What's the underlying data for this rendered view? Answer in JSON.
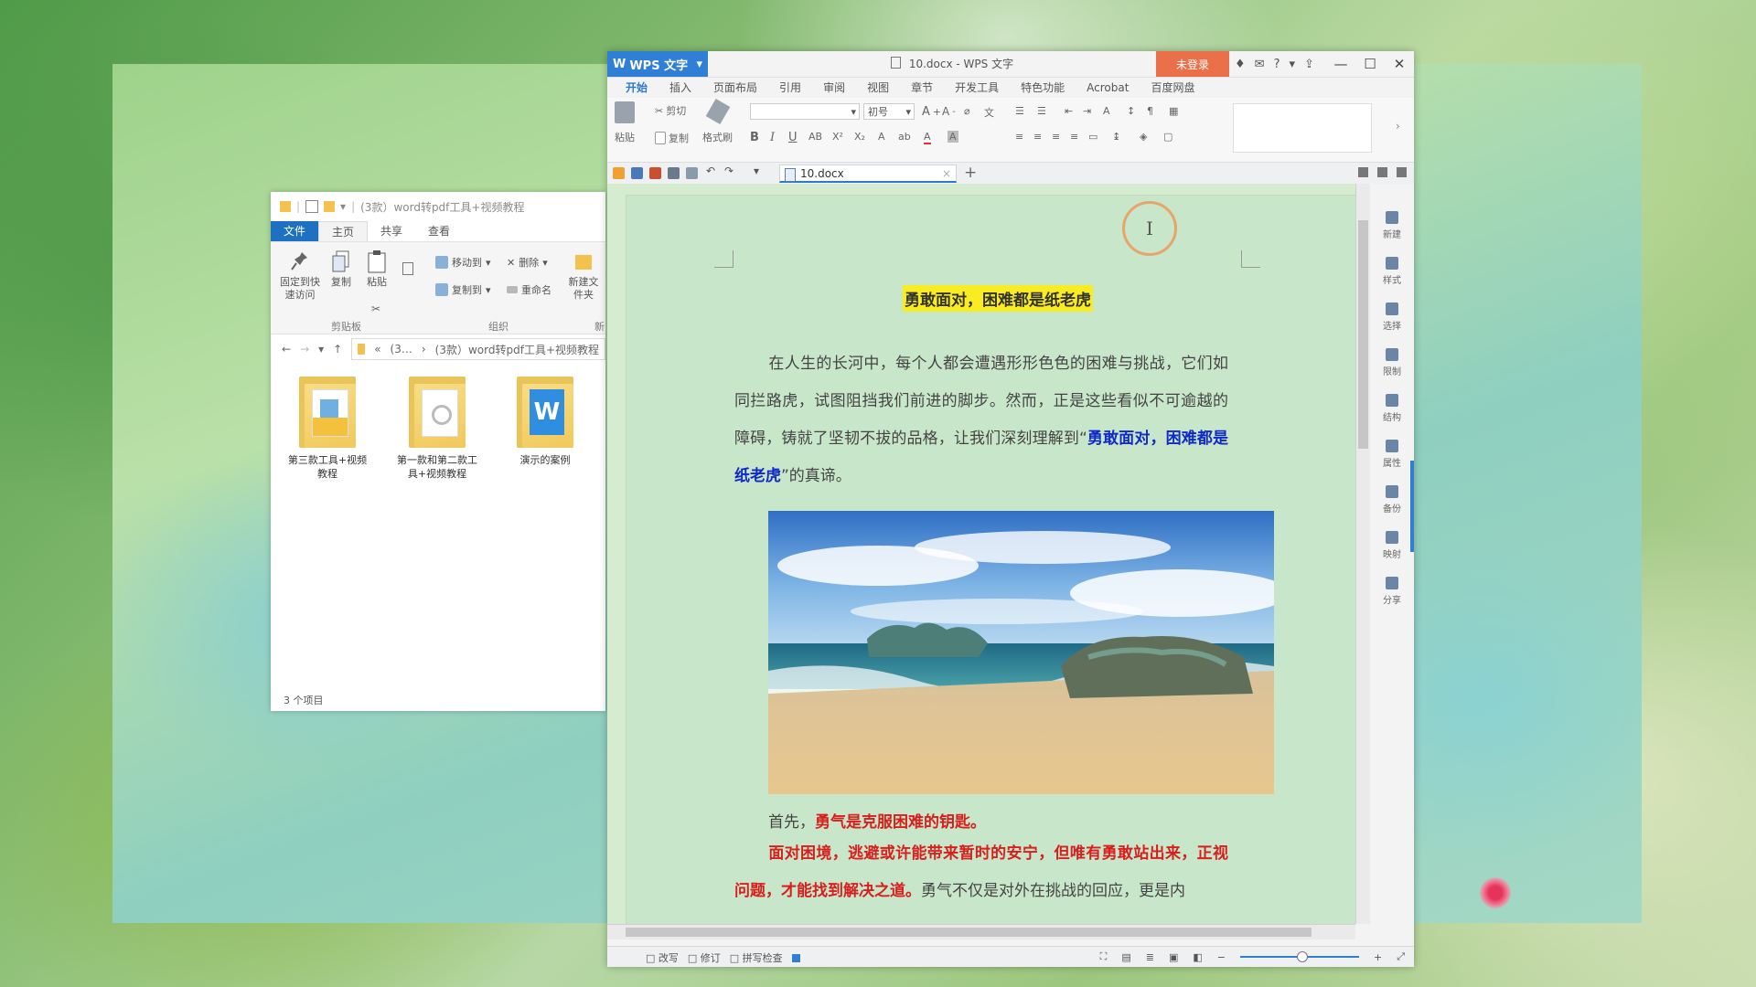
{
  "explorer": {
    "title": "(3款）word转pdf工具+视频教程",
    "tabs": [
      "文件",
      "主页",
      "共享",
      "查看"
    ],
    "ribbon": {
      "pin_label": "固定到快速访问",
      "copy_label": "复制",
      "paste_label": "粘贴",
      "move_to": "移动到",
      "copy_to": "复制到",
      "delete": "删除",
      "rename": "重命名",
      "new_folder": "新建文件夹",
      "groups": [
        "剪贴板",
        "组织",
        "新"
      ]
    },
    "address": {
      "short": "(3…",
      "path": "(3款）word转pdf工具+视频教程"
    },
    "items": [
      {
        "label": "第三款工具+视频教程"
      },
      {
        "label": "第一款和第二款工具+视频教程"
      },
      {
        "label": "演示的案例"
      }
    ],
    "status": "3 个项目"
  },
  "wps": {
    "app_name": "WPS 文字",
    "doc_title": "10.docx - WPS 文字",
    "login": "未登录",
    "menu": [
      "开始",
      "插入",
      "页面布局",
      "引用",
      "审阅",
      "视图",
      "章节",
      "开发工具",
      "特色功能",
      "Acrobat",
      "百度网盘"
    ],
    "toolbar": {
      "paste": "粘贴",
      "cut": "剪切",
      "copy": "复制",
      "format_painter": "格式刷",
      "font_size": "初号"
    },
    "doc_tab": "10.docx",
    "heading": "勇敢面对，困难都是纸老虎",
    "paragraph1_a": "在人生的长河中，每个人都会遭遇形形色色的困难与挑战，它们如同拦路虎，试图阻挡我们前进的脚步。然而，正是这些看似不可逾越的障碍，铸就了坚韧不拔的品格，让我们深刻理解到“",
    "paragraph1_bold": "勇敢面对，困难都是纸老虎",
    "paragraph1_b": "”的真谛。",
    "paragraph2_a": "首先，",
    "paragraph2_bold": "勇气是克服困难的钥匙。",
    "paragraph3_bold": "面对困境，逃避或许能带来暂时的安宁，但唯有勇敢站出来，正视问题，才能找到解决之道。",
    "paragraph3_rest": "勇气不仅是对外在挑战的回应，更是内",
    "side_panel": [
      "新建",
      "样式",
      "选择",
      "限制",
      "结构",
      "属性",
      "备份",
      "映射",
      "分享"
    ],
    "status": {
      "items": [
        "改写",
        "修订",
        "拼写检查"
      ]
    }
  },
  "colors": {
    "wps_blue": "#2f7fd6",
    "login_orange": "#ea7049",
    "doc_bg": "#c8e6c9",
    "highlight_yellow": "#f9ec22",
    "emphasis_blue": "#1029c9",
    "emphasis_red": "#d91e1e"
  }
}
